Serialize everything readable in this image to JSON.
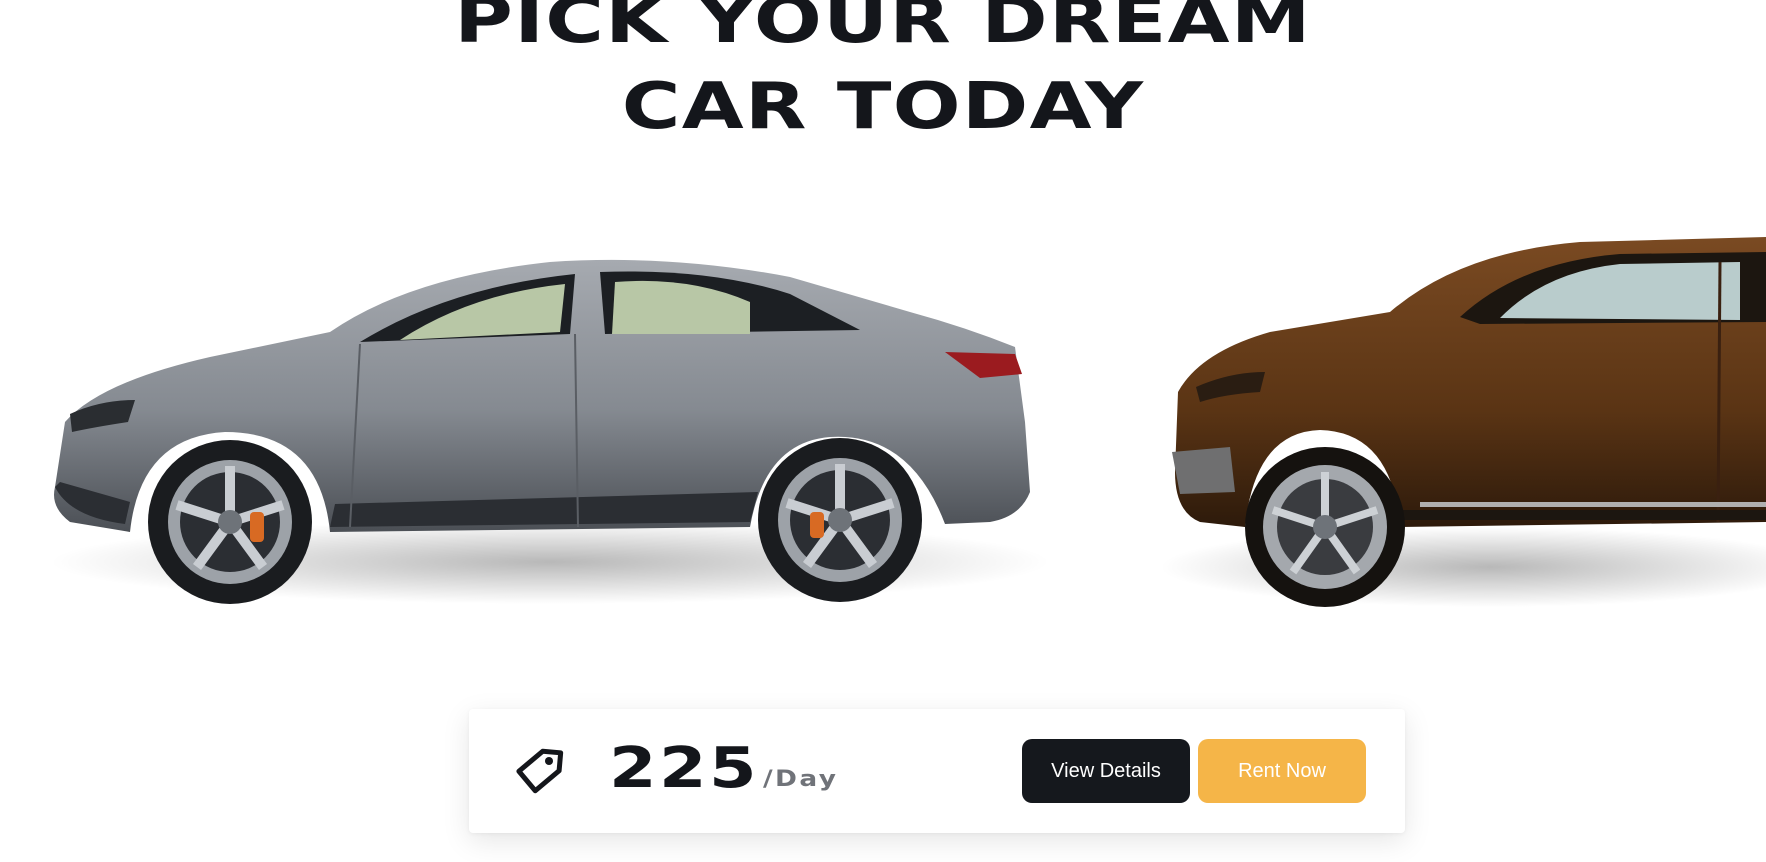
{
  "hero": {
    "title_line_1": "PICK YOUR DREAM",
    "title_line_2": "CAR TODAY"
  },
  "cars": [
    {
      "name": "car-image-left",
      "body_color": "#8a8e94"
    },
    {
      "name": "car-image-right",
      "body_color": "#5a3414"
    }
  ],
  "pricing": {
    "amount": "225",
    "unit": "/Day",
    "icon": "price-tag-icon"
  },
  "actions": {
    "view_details_label": "View Details",
    "rent_now_label": "Rent Now"
  },
  "colors": {
    "dark": "#15181d",
    "accent": "#f5b548"
  }
}
